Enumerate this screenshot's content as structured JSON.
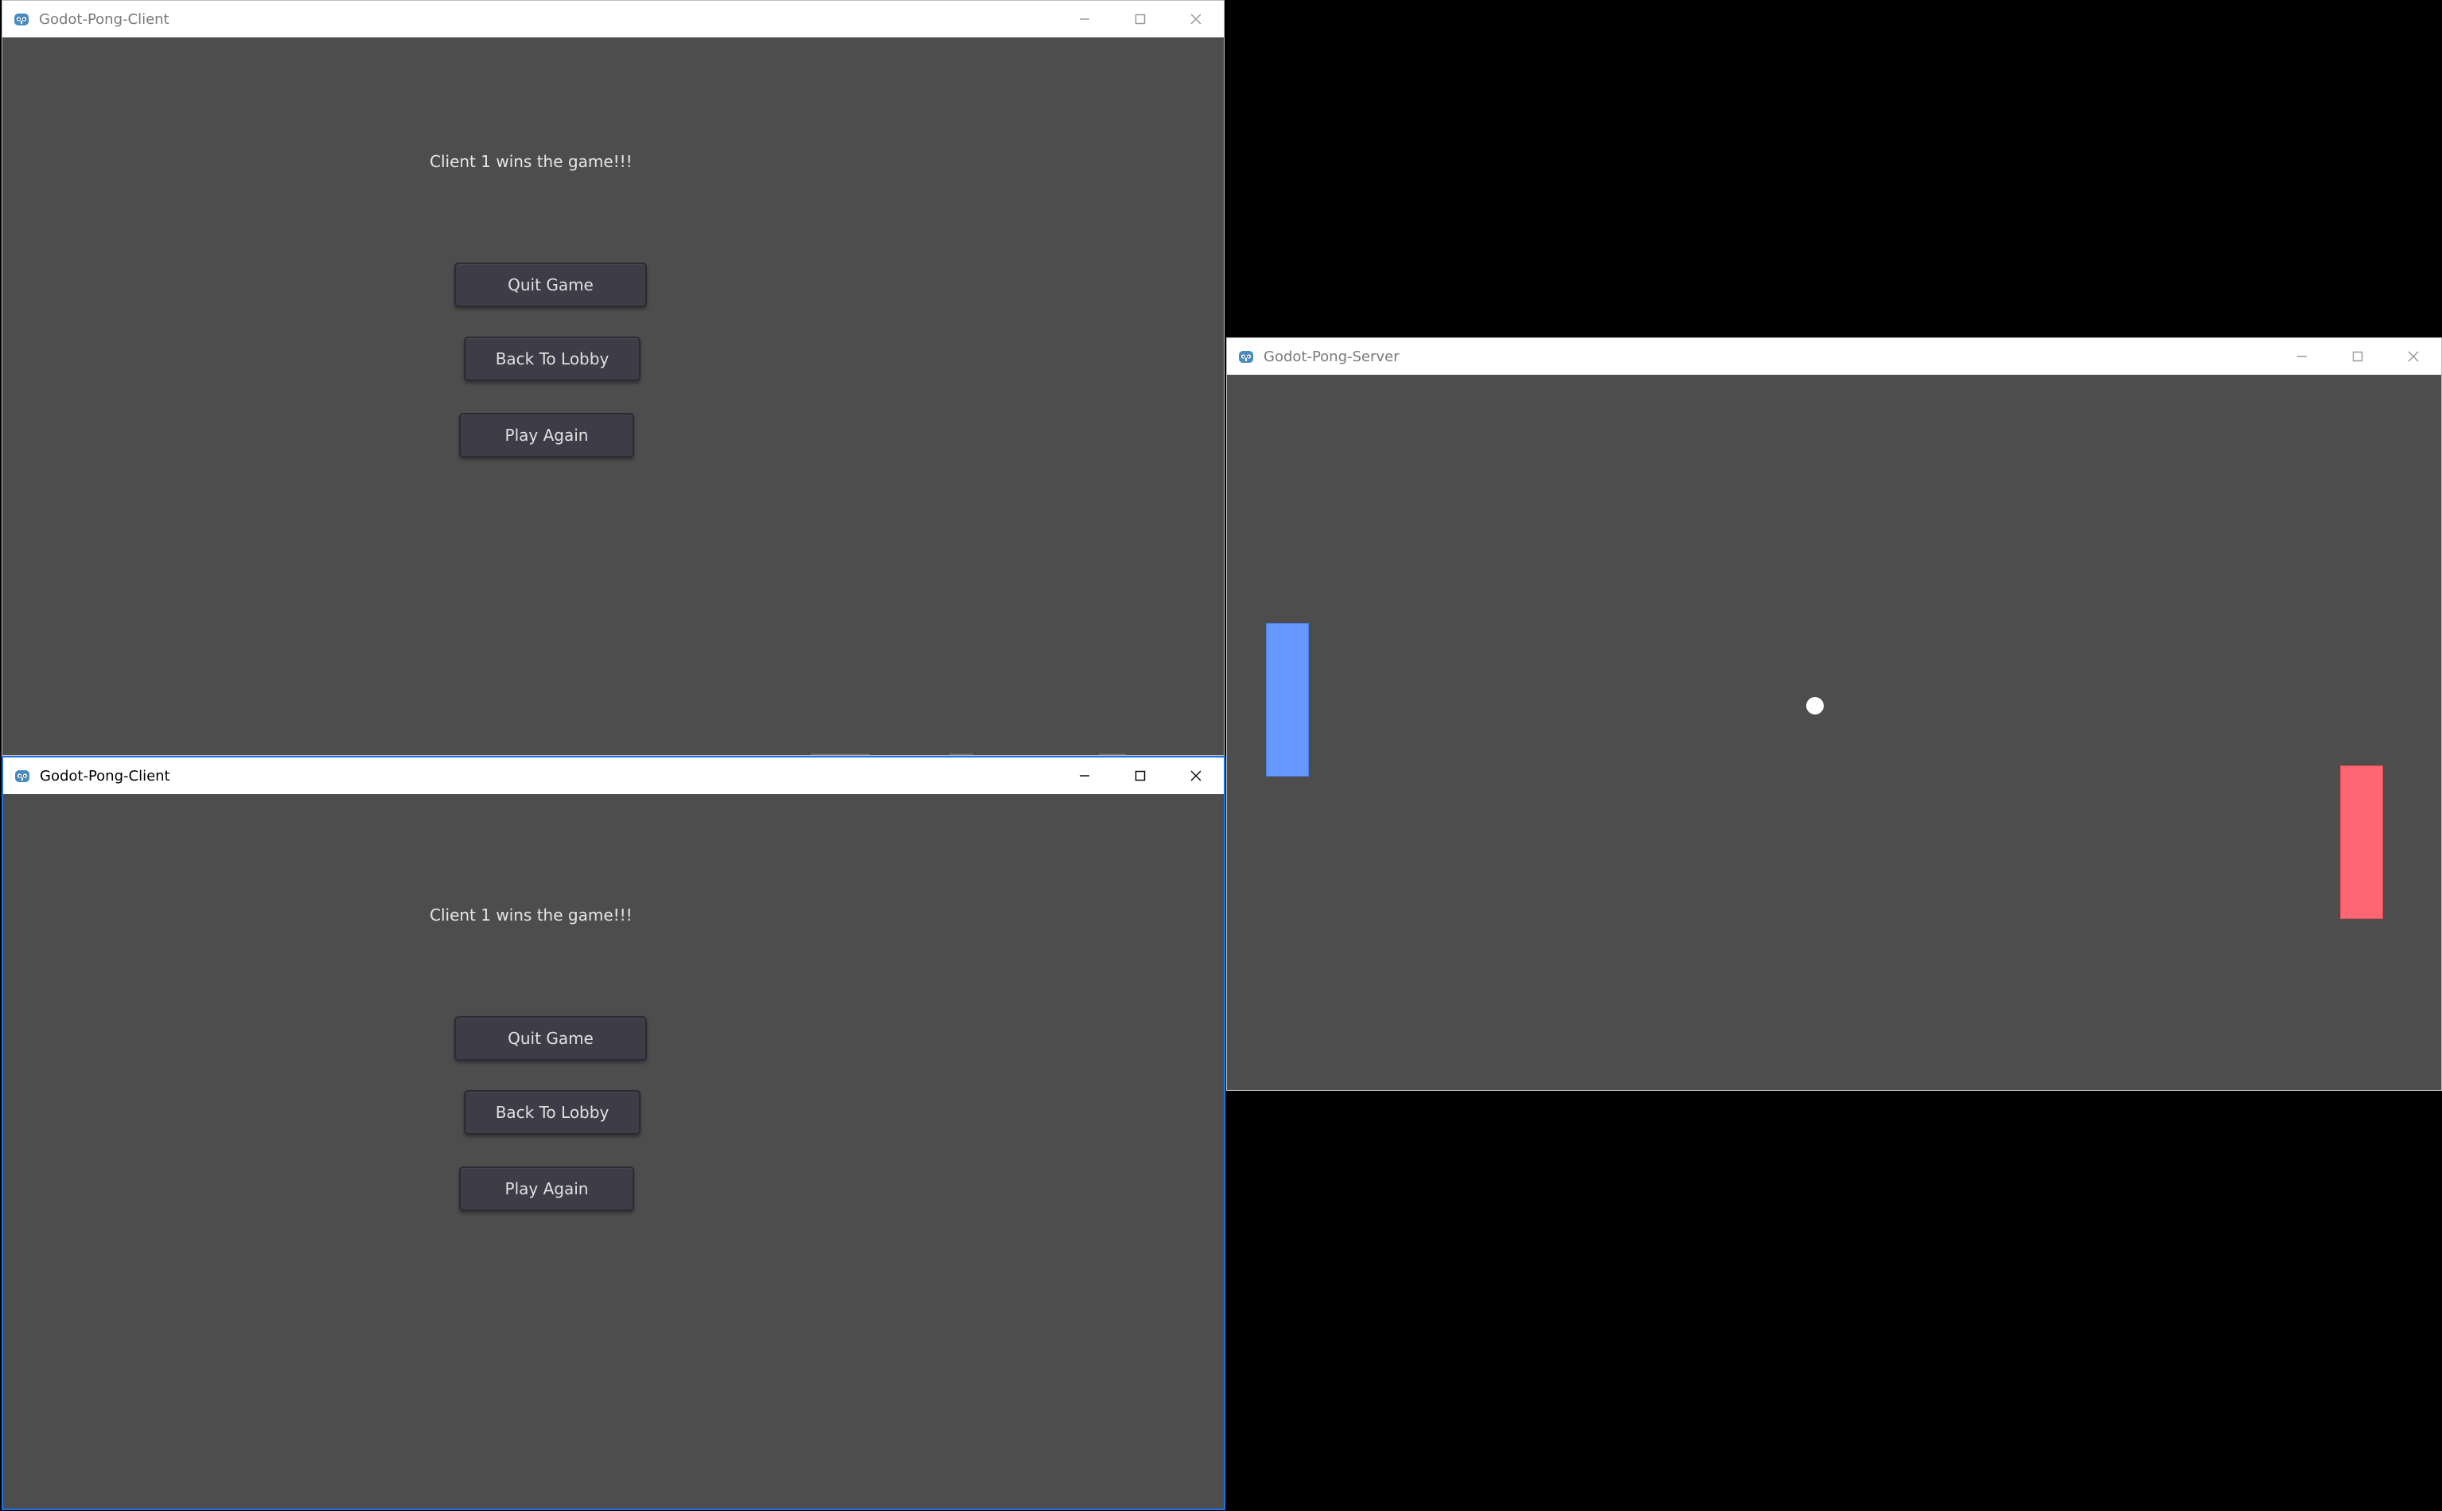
{
  "colors": {
    "desktop": "#000000",
    "window_bg": "#4d4d4d",
    "titlebar": "#ffffff",
    "active_border": "#1a73e8",
    "button_bg": "#3e3c47",
    "paddle_left": "#6699ff",
    "paddle_right": "#ff6673",
    "ball": "#ffffff"
  },
  "icons": {
    "app": "godot-icon",
    "minimize": "minimize-icon",
    "maximize": "maximize-icon",
    "close": "close-icon"
  },
  "client_top": {
    "title": "Godot-Pong-Client",
    "message": "Client 1 wins the game!!!",
    "buttons": {
      "quit": "Quit Game",
      "lobby": "Back To Lobby",
      "again": "Play Again"
    }
  },
  "client_bottom": {
    "title": "Godot-Pong-Client",
    "message": "Client 1 wins the game!!!",
    "buttons": {
      "quit": "Quit Game",
      "lobby": "Back To Lobby",
      "again": "Play Again"
    }
  },
  "server": {
    "title": "Godot-Pong-Server"
  }
}
